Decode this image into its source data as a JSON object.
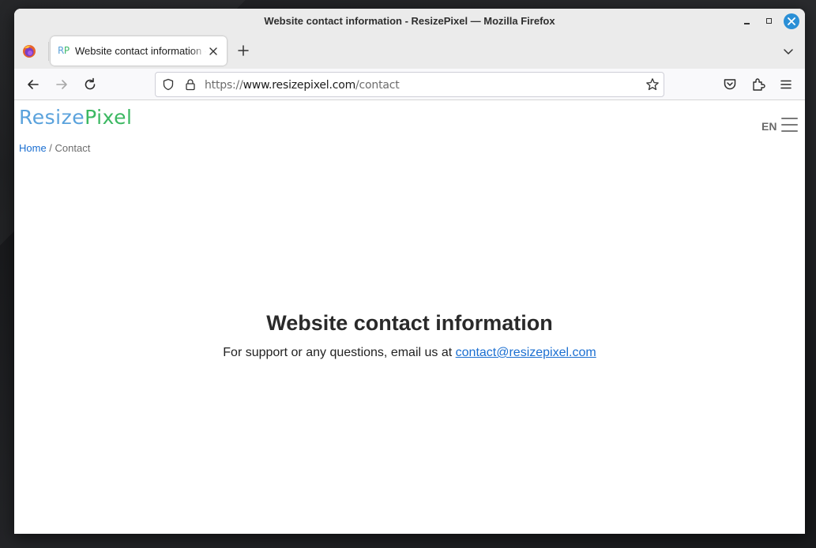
{
  "window": {
    "title": "Website contact information - ResizePixel — Mozilla Firefox"
  },
  "tab": {
    "favicon_r": "R",
    "favicon_p": "P",
    "title": "Website contact information - ResizePixel"
  },
  "urlbar": {
    "scheme": "https://",
    "host": "www.resizepixel.com",
    "path": "/contact"
  },
  "site": {
    "logo_part1": "Resize",
    "logo_part2": "Pixel",
    "breadcrumb_home": "Home",
    "breadcrumb_sep": " / ",
    "breadcrumb_current": "Contact",
    "language": "EN"
  },
  "main": {
    "heading": "Website contact information",
    "text": "For support or any questions, email us at ",
    "email": "contact@resizepixel.com"
  },
  "icons": {
    "window_close": "close-icon",
    "window_minimize": "minimize-icon",
    "window_maximize": "maximize-icon",
    "browser_logo": "firefox-icon",
    "back": "arrow-left-icon",
    "forward": "arrow-right-icon",
    "reload": "reload-icon",
    "shield": "shield-icon",
    "lock": "lock-icon",
    "bookmark": "star-icon",
    "pocket": "pocket-icon",
    "extensions": "puzzle-icon",
    "menu": "hamburger-icon"
  },
  "colors": {
    "link": "#1b6fd1",
    "logo_blue": "#5aa2dc",
    "logo_green": "#3cb862",
    "close_button": "#2a8fd6"
  }
}
